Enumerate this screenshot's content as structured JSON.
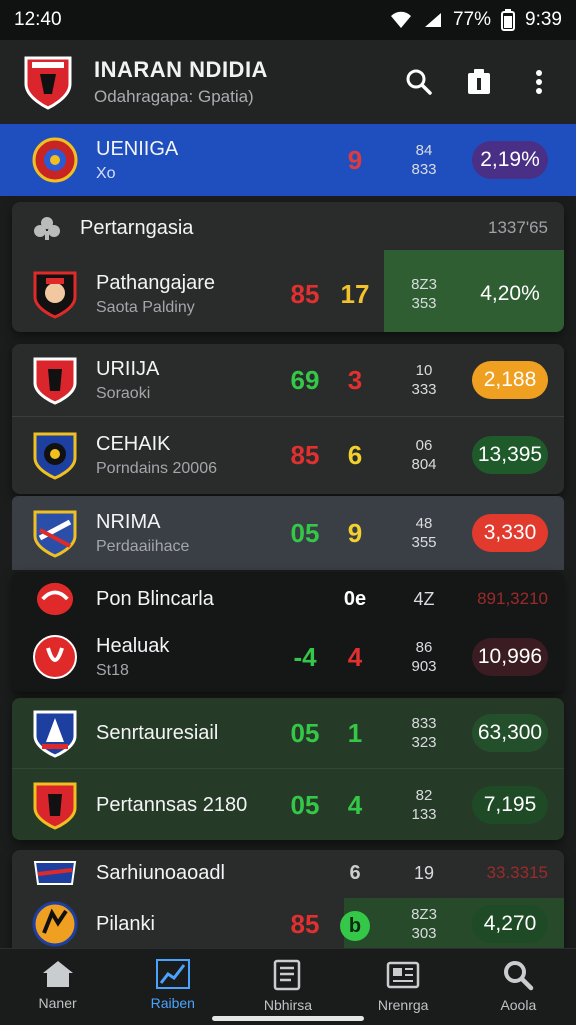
{
  "status_bar": {
    "left_time": "12:40",
    "battery": "77%",
    "right_time": "9:39"
  },
  "app_bar": {
    "title": "INARAN NDIDIA",
    "subtitle": "Odahragapa: Gpatia)"
  },
  "rows": [
    {
      "name": "UENIIGA",
      "sub": "Xo",
      "n1": "",
      "n2": "9",
      "s1": "84",
      "s2": "833",
      "pill": "2,19%",
      "pill_color": "#4a2f86",
      "n2_color": "#e03b3b"
    },
    {
      "name": "Pertarngasia",
      "right": "1337'65"
    },
    {
      "name": "Pathangajare",
      "sub": "Saota Paldiny",
      "n1": "85",
      "n2": "17",
      "s1": "8Z3",
      "s2": "353",
      "pill": "4,20%",
      "n1_color": "#e03030",
      "n2_color": "#f2c12e"
    },
    {
      "name": "URIIJA",
      "sub": "Soraoki",
      "n1": "69",
      "n2": "3",
      "s1": "10",
      "s2": "333",
      "pill": "2,188",
      "pill_color": "#f0a020",
      "n1_color": "#34c748",
      "n2_color": "#e03030"
    },
    {
      "name": "CEHAIK",
      "sub": "Porndains 20006",
      "n1": "85",
      "n2": "6",
      "s1": "06",
      "s2": "804",
      "pill": "13,395",
      "pill_color": "#1e5a2a",
      "n1_color": "#e03030",
      "n2_color": "#f2d02e"
    },
    {
      "name": "NRIMA",
      "sub": "Perdaaiihace",
      "n1": "05",
      "n2": "9",
      "s1": "48",
      "s2": "355",
      "pill": "3,330",
      "pill_color": "#e23b2e",
      "n1_color": "#34c748",
      "n2_color": "#f2d02e"
    },
    {
      "name": "Pon Blincarla",
      "n2": "0e",
      "s1": "4Z",
      "right": "891,3210"
    },
    {
      "name": "Healuak",
      "sub": "St18",
      "n1": "-4",
      "n2": "4",
      "s1": "86",
      "s2": "903",
      "pill": "10,996",
      "pill_color": "#3a1c22",
      "n1_color": "#34c748",
      "n2_color": "#e03030"
    },
    {
      "name": "Senrtauresiail",
      "n1": "05",
      "n2": "1",
      "s1": "833",
      "s2": "323",
      "pill": "63,300",
      "pill_color": "#234f2a",
      "n1_color": "#34c748",
      "n2_color": "#34c748"
    },
    {
      "name": "Pertannsas 2180",
      "n1": "05",
      "n2": "4",
      "s1": "82",
      "s2": "133",
      "pill": "7,195",
      "pill_color": "#1f4a26",
      "n1_color": "#34c748",
      "n2_color": "#34c748"
    },
    {
      "name": "Sarhiunoaoadl",
      "n2": "6",
      "s1": "19",
      "right": "33.3315"
    },
    {
      "name": "Pilanki",
      "n1": "85",
      "n2": "b",
      "s1": "8Z3",
      "s2": "303",
      "pill": "4,270",
      "pill_color": "#1f4a26",
      "n1_color": "#e03030",
      "n2_color": "#34c748"
    }
  ],
  "bottom_nav": [
    {
      "label": "Naner",
      "icon": "home-icon"
    },
    {
      "label": "Raiben",
      "icon": "chart-icon"
    },
    {
      "label": "Nbhirsa",
      "icon": "news-icon"
    },
    {
      "label": "Nrenrga",
      "icon": "newspaper-icon"
    },
    {
      "label": "Aoola",
      "icon": "search-icon"
    }
  ]
}
